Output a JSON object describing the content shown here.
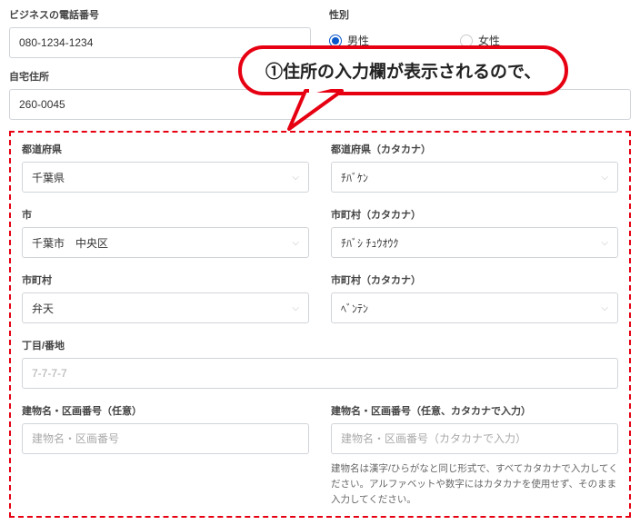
{
  "callout": {
    "text": "①住所の入力欄が表示されるので、"
  },
  "phone": {
    "label": "ビジネスの電話番号",
    "value": "080-1234-1234"
  },
  "gender": {
    "label": "性別",
    "option_male": "男性",
    "option_female": "女性"
  },
  "home_address": {
    "label": "自宅住所",
    "value": "260-0045"
  },
  "prefecture": {
    "label": "都道府県",
    "value": "千葉県"
  },
  "prefecture_kana": {
    "label": "都道府県（カタカナ）",
    "value": "ﾁﾊﾞｹﾝ"
  },
  "city": {
    "label": "市",
    "value": "千葉市　中央区"
  },
  "city_kana": {
    "label": "市町村（カタカナ）",
    "value": "ﾁﾊﾞｼ ﾁｭｳｵｳｸ"
  },
  "town": {
    "label": "市町村",
    "value": "弁天"
  },
  "town_kana": {
    "label": "市町村（カタカナ）",
    "value": "ﾍﾞﾝﾃﾝ"
  },
  "chome": {
    "label": "丁目/番地",
    "placeholder": "7-7-7-7"
  },
  "building": {
    "label": "建物名・区画番号（任意）",
    "placeholder": "建物名・区画番号"
  },
  "building_kana": {
    "label": "建物名・区画番号（任意、カタカナで入力）",
    "placeholder": "建物名・区画番号（カタカナで入力）",
    "hint": "建物名は漢字/ひらがなと同じ形式で、すべてカタカナで入力してください。アルファベットや数字にはカタカナを使用せず、そのまま入力してください。"
  }
}
